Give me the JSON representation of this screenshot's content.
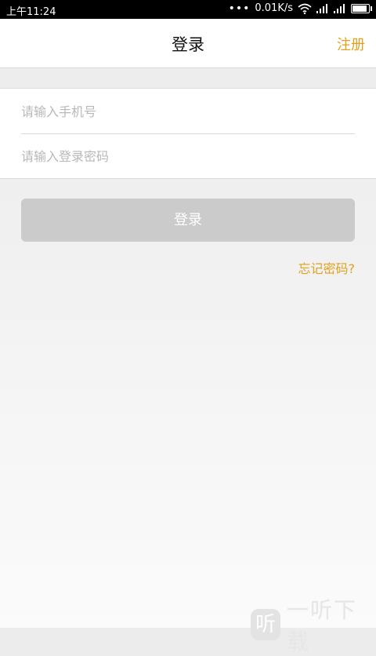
{
  "status_bar": {
    "time": "上午11:24",
    "dots": "•••",
    "network_speed": "0.01K/s",
    "icons": [
      "wifi-icon",
      "signal-icon",
      "signal-icon",
      "battery-icon"
    ],
    "battery_level": 0.9
  },
  "navbar": {
    "title": "登录",
    "register_label": "注册",
    "accent_color": "#e0a21e"
  },
  "form": {
    "phone": {
      "placeholder": "请输入手机号",
      "value": ""
    },
    "password": {
      "placeholder": "请输入登录密码",
      "value": ""
    }
  },
  "actions": {
    "login_label": "登录",
    "forgot_label": "忘记密码?"
  },
  "watermark": {
    "badge": "听",
    "text": "一听下载"
  }
}
